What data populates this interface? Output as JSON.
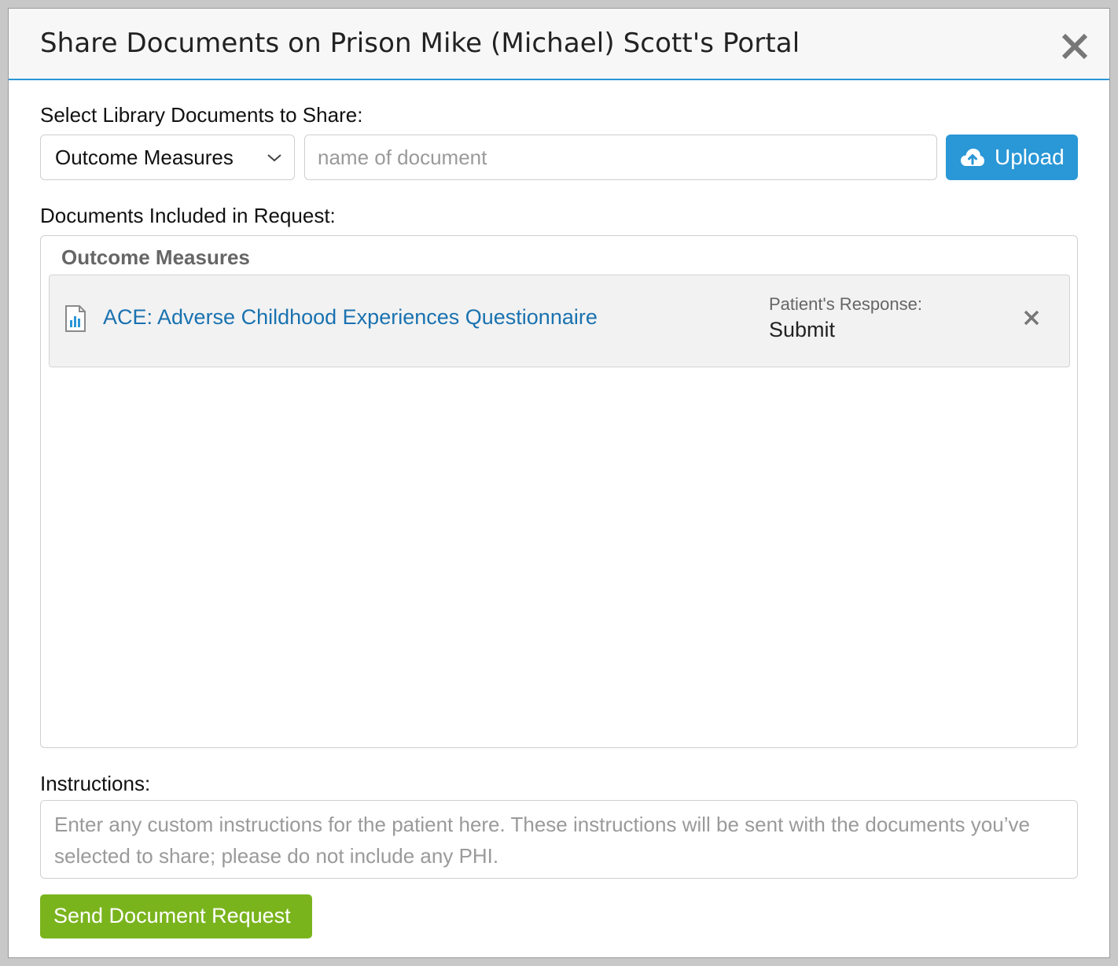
{
  "modal": {
    "title": "Share Documents on Prison Mike (Michael) Scott's Portal",
    "close_icon": "close-icon"
  },
  "library": {
    "label": "Select Library Documents to Share:",
    "category_select": {
      "selected": "Outcome Measures",
      "icon": "chevron-down-icon"
    },
    "search": {
      "value": "",
      "placeholder": "name of document"
    },
    "upload_button": {
      "label": "Upload",
      "icon": "cloud-upload-icon"
    }
  },
  "included": {
    "label": "Documents Included in Request:",
    "groups": [
      {
        "heading": "Outcome Measures",
        "documents": [
          {
            "icon": "chart-document-icon",
            "name": "ACE: Adverse Childhood Experiences Questionnaire",
            "response_label": "Patient's Response:",
            "response_value": "Submit",
            "remove_icon": "close-icon"
          }
        ]
      }
    ]
  },
  "instructions": {
    "label": "Instructions:",
    "value": "",
    "placeholder": "Enter any custom instructions for the patient here. These instructions will be sent with the documents you’ve selected to share; please do not include any PHI."
  },
  "send_button": {
    "label": "Send Document Request"
  },
  "colors": {
    "accent_blue": "#2a97d6",
    "link_blue": "#1a72b0",
    "send_green": "#7ab41d",
    "header_bg": "#f7f7f7",
    "row_bg": "#f2f2f2"
  }
}
